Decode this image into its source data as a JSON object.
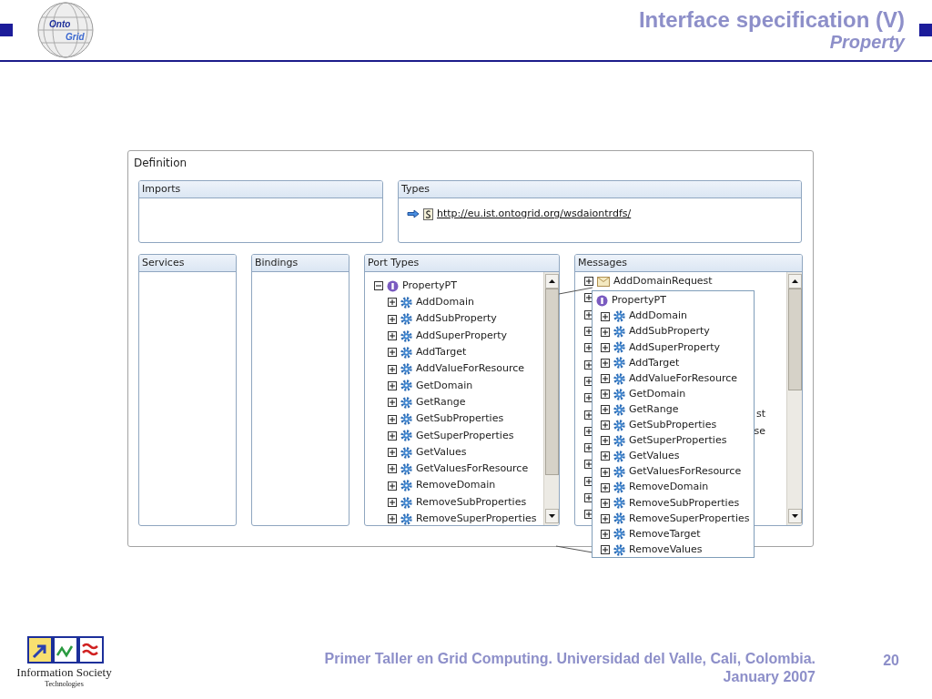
{
  "slide": {
    "title": "Interface specification (V)",
    "subtitle": "Property",
    "logo": {
      "line1": "Onto",
      "line2": "Grid"
    }
  },
  "editor": {
    "title": "Definition",
    "imports": {
      "title": "Imports"
    },
    "types": {
      "title": "Types",
      "link": "http://eu.ist.ontogrid.org/wsdaiontrdfs/"
    },
    "services": {
      "title": "Services"
    },
    "bindings": {
      "title": "Bindings"
    },
    "port_types": {
      "title": "Port Types",
      "tree": [
        {
          "label": "PropertyPT",
          "expanded": true,
          "children": [
            {
              "label": "AddDomain",
              "expanded": false
            },
            {
              "label": "AddSubProperty",
              "expanded": false
            },
            {
              "label": "AddSuperProperty",
              "expanded": false
            },
            {
              "label": "AddTarget",
              "expanded": false
            },
            {
              "label": "AddValueForResource",
              "expanded": false
            },
            {
              "label": "GetDomain",
              "expanded": false
            },
            {
              "label": "GetRange",
              "expanded": false
            },
            {
              "label": "GetSubProperties",
              "expanded": false
            },
            {
              "label": "GetSuperProperties",
              "expanded": false
            },
            {
              "label": "GetValues",
              "expanded": false
            },
            {
              "label": "GetValuesForResource",
              "expanded": false
            },
            {
              "label": "RemoveDomain",
              "expanded": false
            },
            {
              "label": "RemoveSubProperties",
              "expanded": false
            },
            {
              "label": "RemoveSuperProperties",
              "expanded": false
            }
          ]
        }
      ]
    },
    "messages": {
      "title": "Messages",
      "rows": [
        {
          "expanded": false,
          "label": "AddDomainRequest"
        },
        {
          "expanded": false
        },
        {
          "expanded": false
        },
        {
          "expanded": false
        },
        {
          "expanded": false
        },
        {
          "expanded": false
        },
        {
          "expanded": false
        },
        {
          "expanded": false
        },
        {
          "expanded": false,
          "label": "st"
        },
        {
          "expanded": false,
          "label": "se"
        },
        {
          "expanded": false
        },
        {
          "expanded": false
        },
        {
          "expanded": false
        },
        {
          "expanded": false
        },
        {
          "expanded": false
        }
      ]
    },
    "popup": {
      "title": "PropertyPT",
      "items": [
        {
          "label": "AddDomain",
          "expanded": false
        },
        {
          "label": "AddSubProperty",
          "expanded": false
        },
        {
          "label": "AddSuperProperty",
          "expanded": false
        },
        {
          "label": "AddTarget",
          "expanded": false
        },
        {
          "label": "AddValueForResource",
          "expanded": false
        },
        {
          "label": "GetDomain",
          "expanded": false
        },
        {
          "label": "GetRange",
          "expanded": false
        },
        {
          "label": "GetSubProperties",
          "expanded": false
        },
        {
          "label": "GetSuperProperties",
          "expanded": false
        },
        {
          "label": "GetValues",
          "expanded": false
        },
        {
          "label": "GetValuesForResource",
          "expanded": false
        },
        {
          "label": "RemoveDomain",
          "expanded": false
        },
        {
          "label": "RemoveSubProperties",
          "expanded": false
        },
        {
          "label": "RemoveSuperProperties",
          "expanded": false
        },
        {
          "label": "RemoveTarget",
          "expanded": false
        },
        {
          "label": "RemoveValues",
          "expanded": false
        }
      ]
    }
  },
  "footer": {
    "text": "Primer Taller en Grid Computing. Universidad del Valle, Cali, Colombia.",
    "date": "January 2007",
    "page": "20",
    "logo": {
      "line1": "Information Society",
      "line2": "Technologies"
    }
  }
}
